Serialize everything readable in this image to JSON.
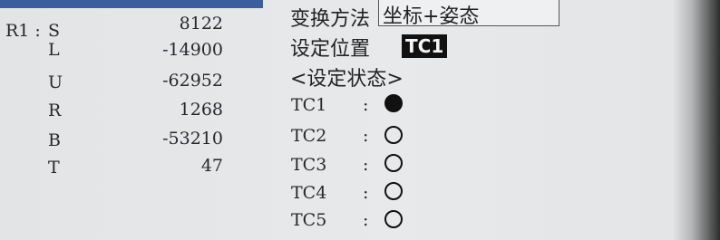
{
  "robot_label": "R1 :",
  "axes": [
    {
      "name": "S",
      "value": "8122"
    },
    {
      "name": "L",
      "value": "-14900"
    },
    {
      "name": "U",
      "value": "-62952"
    },
    {
      "name": "R",
      "value": "1268"
    },
    {
      "name": "B",
      "value": "-53210"
    },
    {
      "name": "T",
      "value": "47"
    }
  ],
  "conversion": {
    "label": "变换方法",
    "value": "坐标+姿态"
  },
  "set_position": {
    "label": "设定位置",
    "value": "TC1"
  },
  "set_state": {
    "heading": "<设定状态>",
    "items": [
      {
        "label": "TC1",
        "colon": ":",
        "selected": true
      },
      {
        "label": "TC2",
        "colon": ":",
        "selected": false
      },
      {
        "label": "TC3",
        "colon": ":",
        "selected": false
      },
      {
        "label": "TC4",
        "colon": ":",
        "selected": false
      },
      {
        "label": "TC5",
        "colon": ":",
        "selected": false
      }
    ]
  },
  "colors": {
    "background": "#e4e6e8",
    "text": "#26282b",
    "highlight_bg": "#111111",
    "highlight_text": "#f5f5f5",
    "title_bar": "#3a5f9c"
  }
}
